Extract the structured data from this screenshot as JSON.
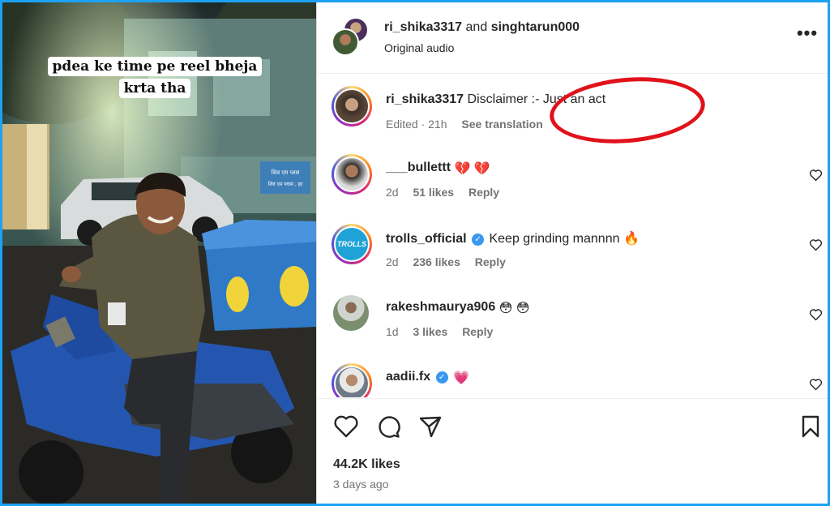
{
  "media": {
    "caption_line1": "pdea ke time pe reel bheja",
    "caption_line2": "krta tha",
    "sign_text_1": "शिव एम प्लस",
    "sign_text_2": "शिव एम प्लास , हर"
  },
  "header": {
    "user1": "ri_shika3317",
    "joiner": "and",
    "user2": "singhtarun000",
    "audio": "Original audio",
    "more_icon": "more-horizontal-icon"
  },
  "caption_comment": {
    "user": "ri_shika3317",
    "text": "Disclaimer :- Just an act",
    "edited": "Edited · 21h",
    "see_translation": "See translation"
  },
  "comments": [
    {
      "user": "___bullettt",
      "text": "💔 💔",
      "time": "2d",
      "likes": "51 likes",
      "reply": "Reply",
      "verified": false
    },
    {
      "user": "trolls_official",
      "text": "Keep grinding mannnn 🔥",
      "time": "2d",
      "likes": "236 likes",
      "reply": "Reply",
      "verified": true,
      "avatar_text": "TROLLS"
    },
    {
      "user": "rakeshmaurya906",
      "text": "😳 😳",
      "time": "1d",
      "likes": "3 likes",
      "reply": "Reply",
      "verified": false
    },
    {
      "user": "aadii.fx",
      "text": "💗",
      "verified": true
    }
  ],
  "footer": {
    "likes": "44.2K likes",
    "posted": "3 days ago"
  },
  "colors": {
    "highlight_oval": "#e0121b",
    "frame_border": "#1da1f2",
    "verified": "#3897f0"
  }
}
